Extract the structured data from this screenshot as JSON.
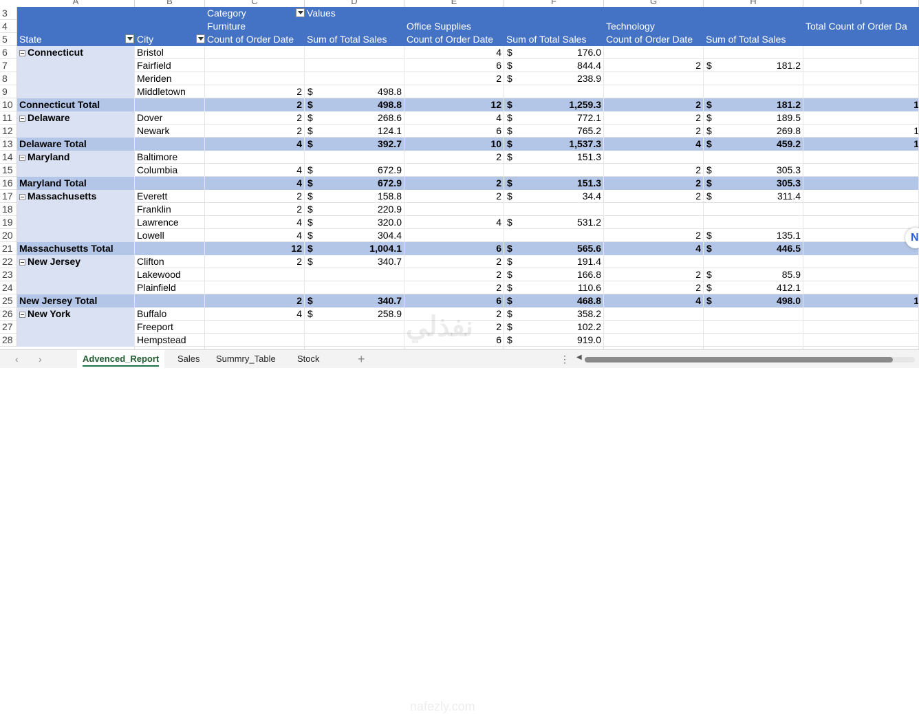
{
  "colors": {
    "header": "#4472c4",
    "total": "#b4c6e7",
    "state": "#d9e1f2"
  },
  "column_letters": [
    "A",
    "B",
    "C",
    "D",
    "E",
    "F",
    "G",
    "H",
    "I"
  ],
  "header": {
    "category_label": "Category",
    "values_label": "Values",
    "furniture": "Furniture",
    "office": "Office Supplies",
    "technology": "Technology",
    "state": "State",
    "city": "City",
    "count": "Count of Order Date",
    "sum": "Sum of Total Sales",
    "total_count": "Total Count of Order Da"
  },
  "rows": [
    {
      "n": "6",
      "state": "Connecticut",
      "city": "Bristol",
      "fc": "",
      "fd": "",
      "fs": "",
      "oc": "4",
      "od": "$",
      "os": "176.0",
      "tc": "",
      "td": "",
      "ts": "",
      "tot": ""
    },
    {
      "n": "7",
      "state": "",
      "city": "Fairfield",
      "fc": "",
      "fd": "",
      "fs": "",
      "oc": "6",
      "od": "$",
      "os": "844.4",
      "tc": "2",
      "td": "$",
      "ts": "181.2",
      "tot": ""
    },
    {
      "n": "8",
      "state": "",
      "city": "Meriden",
      "fc": "",
      "fd": "",
      "fs": "",
      "oc": "2",
      "od": "$",
      "os": "238.9",
      "tc": "",
      "td": "",
      "ts": "",
      "tot": ""
    },
    {
      "n": "9",
      "state": "",
      "city": "Middletown",
      "fc": "2",
      "fd": "$",
      "fs": "498.8",
      "oc": "",
      "od": "",
      "os": "",
      "tc": "",
      "td": "",
      "ts": "",
      "tot": ""
    },
    {
      "n": "10",
      "total": "Connecticut Total",
      "fc": "2",
      "fd": "$",
      "fs": "498.8",
      "oc": "12",
      "od": "$",
      "os": "1,259.3",
      "tc": "2",
      "td": "$",
      "ts": "181.2",
      "tot": "1"
    },
    {
      "n": "11",
      "state": "Delaware",
      "city": "Dover",
      "fc": "2",
      "fd": "$",
      "fs": "268.6",
      "oc": "4",
      "od": "$",
      "os": "772.1",
      "tc": "2",
      "td": "$",
      "ts": "189.5",
      "tot": ""
    },
    {
      "n": "12",
      "state": "",
      "city": "Newark",
      "fc": "2",
      "fd": "$",
      "fs": "124.1",
      "oc": "6",
      "od": "$",
      "os": "765.2",
      "tc": "2",
      "td": "$",
      "ts": "269.8",
      "tot": "1"
    },
    {
      "n": "13",
      "total": "Delaware Total",
      "fc": "4",
      "fd": "$",
      "fs": "392.7",
      "oc": "10",
      "od": "$",
      "os": "1,537.3",
      "tc": "4",
      "td": "$",
      "ts": "459.2",
      "tot": "1"
    },
    {
      "n": "14",
      "state": "Maryland",
      "city": "Baltimore",
      "fc": "",
      "fd": "",
      "fs": "",
      "oc": "2",
      "od": "$",
      "os": "151.3",
      "tc": "",
      "td": "",
      "ts": "",
      "tot": ""
    },
    {
      "n": "15",
      "state": "",
      "city": "Columbia",
      "fc": "4",
      "fd": "$",
      "fs": "672.9",
      "oc": "",
      "od": "",
      "os": "",
      "tc": "2",
      "td": "$",
      "ts": "305.3",
      "tot": ""
    },
    {
      "n": "16",
      "total": "Maryland Total",
      "fc": "4",
      "fd": "$",
      "fs": "672.9",
      "oc": "2",
      "od": "$",
      "os": "151.3",
      "tc": "2",
      "td": "$",
      "ts": "305.3",
      "tot": ""
    },
    {
      "n": "17",
      "state": "Massachusetts",
      "city": "Everett",
      "fc": "2",
      "fd": "$",
      "fs": "158.8",
      "oc": "2",
      "od": "$",
      "os": "34.4",
      "tc": "2",
      "td": "$",
      "ts": "311.4",
      "tot": ""
    },
    {
      "n": "18",
      "state": "",
      "city": "Franklin",
      "fc": "2",
      "fd": "$",
      "fs": "220.9",
      "oc": "",
      "od": "",
      "os": "",
      "tc": "",
      "td": "",
      "ts": "",
      "tot": ""
    },
    {
      "n": "19",
      "state": "",
      "city": "Lawrence",
      "fc": "4",
      "fd": "$",
      "fs": "320.0",
      "oc": "4",
      "od": "$",
      "os": "531.2",
      "tc": "",
      "td": "",
      "ts": "",
      "tot": ""
    },
    {
      "n": "20",
      "state": "",
      "city": "Lowell",
      "fc": "4",
      "fd": "$",
      "fs": "304.4",
      "oc": "",
      "od": "",
      "os": "",
      "tc": "2",
      "td": "$",
      "ts": "135.1",
      "tot": ""
    },
    {
      "n": "21",
      "total": "Massachusetts Total",
      "fc": "12",
      "fd": "$",
      "fs": "1,004.1",
      "oc": "6",
      "od": "$",
      "os": "565.6",
      "tc": "4",
      "td": "$",
      "ts": "446.5",
      "tot": ""
    },
    {
      "n": "22",
      "state": "New Jersey",
      "city": "Clifton",
      "fc": "2",
      "fd": "$",
      "fs": "340.7",
      "oc": "2",
      "od": "$",
      "os": "191.4",
      "tc": "",
      "td": "",
      "ts": "",
      "tot": ""
    },
    {
      "n": "23",
      "state": "",
      "city": "Lakewood",
      "fc": "",
      "fd": "",
      "fs": "",
      "oc": "2",
      "od": "$",
      "os": "166.8",
      "tc": "2",
      "td": "$",
      "ts": "85.9",
      "tot": ""
    },
    {
      "n": "24",
      "state": "",
      "city": "Plainfield",
      "fc": "",
      "fd": "",
      "fs": "",
      "oc": "2",
      "od": "$",
      "os": "110.6",
      "tc": "2",
      "td": "$",
      "ts": "412.1",
      "tot": ""
    },
    {
      "n": "25",
      "total": "New Jersey Total",
      "fc": "2",
      "fd": "$",
      "fs": "340.7",
      "oc": "6",
      "od": "$",
      "os": "468.8",
      "tc": "4",
      "td": "$",
      "ts": "498.0",
      "tot": "1"
    },
    {
      "n": "26",
      "state": "New York",
      "city": "Buffalo",
      "fc": "4",
      "fd": "$",
      "fs": "258.9",
      "oc": "2",
      "od": "$",
      "os": "358.2",
      "tc": "",
      "td": "",
      "ts": "",
      "tot": ""
    },
    {
      "n": "27",
      "state": "",
      "city": "Freeport",
      "fc": "",
      "fd": "",
      "fs": "",
      "oc": "2",
      "od": "$",
      "os": "102.2",
      "tc": "",
      "td": "",
      "ts": "",
      "tot": ""
    },
    {
      "n": "28",
      "state": "",
      "city": "Hempstead",
      "fc": "",
      "fd": "",
      "fs": "",
      "oc": "6",
      "od": "$",
      "os": "919.0",
      "tc": "",
      "td": "",
      "ts": "",
      "tot": ""
    }
  ],
  "header_row_numbers": [
    "3",
    "4",
    "5"
  ],
  "tabs": [
    "Advenced_Report",
    "Sales",
    "Summry_Table",
    "Stock"
  ],
  "active_tab": 0,
  "add_sheet": "+",
  "watermark": "نفذلي",
  "watermark_url": "nafezly.com"
}
